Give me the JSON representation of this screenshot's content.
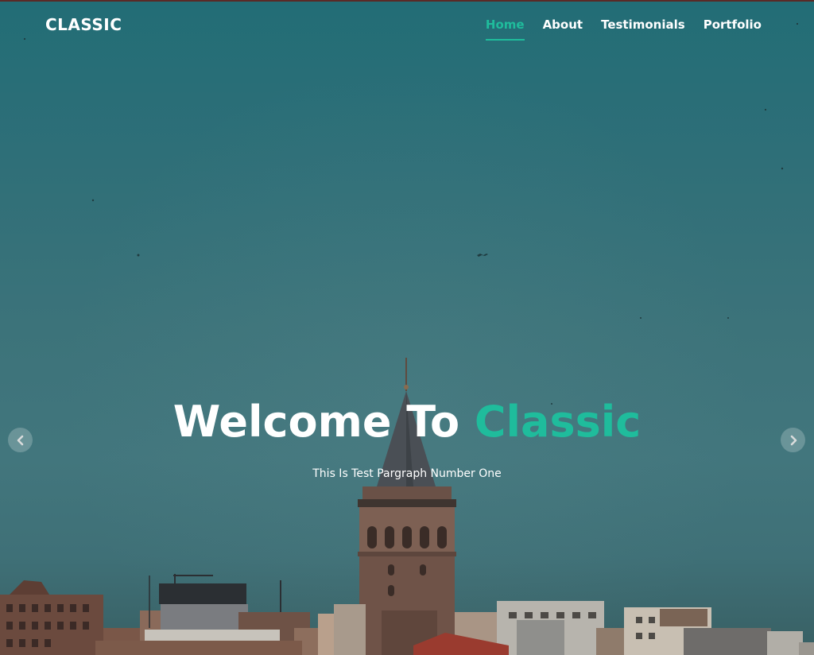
{
  "brand": {
    "name": "CLASSIC"
  },
  "nav": {
    "items": [
      {
        "label": "Home",
        "active": true
      },
      {
        "label": "About",
        "active": false
      },
      {
        "label": "Testimonials",
        "active": false
      },
      {
        "label": "Portfolio",
        "active": false
      }
    ]
  },
  "hero": {
    "title_main": "Welcome To",
    "title_accent": "Classic",
    "subtitle": "This Is Test Pargraph Number One"
  },
  "carousel": {
    "prev_icon": "chevron-left-icon",
    "next_icon": "chevron-right-icon"
  },
  "colors": {
    "accent": "#1fbc9c",
    "nav_text": "#ffffff",
    "sky": "#2f6f78"
  }
}
